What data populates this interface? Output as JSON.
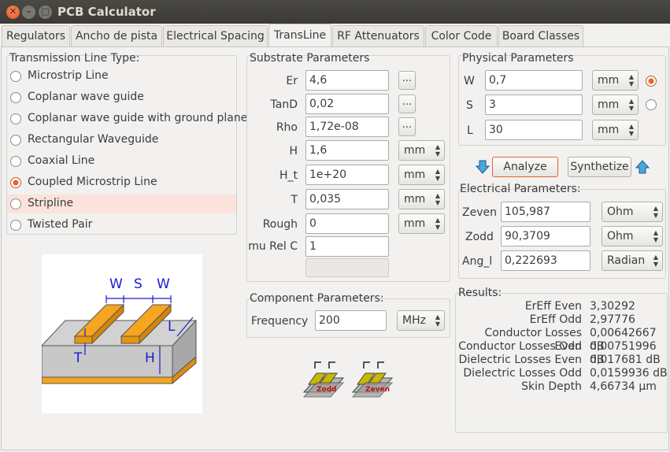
{
  "window": {
    "title": "PCB Calculator"
  },
  "tabs": [
    "Regulators",
    "Ancho de pista",
    "Electrical Spacing",
    "TransLine",
    "RF Attenuators",
    "Color Code",
    "Board Classes"
  ],
  "active_tab": "TransLine",
  "line_type": {
    "label": "Transmission Line Type:",
    "options": [
      "Microstrip Line",
      "Coplanar wave guide",
      "Coplanar wave guide with ground plane",
      "Rectangular Waveguide",
      "Coaxial Line",
      "Coupled Microstrip Line",
      "Stripline",
      "Twisted Pair"
    ],
    "selected": "Coupled Microstrip Line",
    "hover": "Stripline"
  },
  "diagram": {
    "w1": "W",
    "s": "S",
    "w2": "W",
    "t": "T",
    "h": "H",
    "l": "L"
  },
  "substrate": {
    "label": "Substrate Parameters",
    "er": {
      "label": "Er",
      "value": "4,6",
      "btn": "..."
    },
    "tand": {
      "label": "TanD",
      "value": "0,02",
      "btn": "..."
    },
    "rho": {
      "label": "Rho",
      "value": "1,72e-08",
      "btn": "..."
    },
    "h": {
      "label": "H",
      "value": "1,6",
      "unit": "mm"
    },
    "h_t": {
      "label": "H_t",
      "value": "1e+20",
      "unit": "mm"
    },
    "t": {
      "label": "T",
      "value": "0,035",
      "unit": "mm"
    },
    "rough": {
      "label": "Rough",
      "value": "0",
      "unit": "mm"
    },
    "murelc": {
      "label": "mu Rel C",
      "value": "1"
    }
  },
  "component": {
    "label": "Component Parameters:",
    "freq_label": "Frequency",
    "freq_value": "200",
    "freq_unit": "MHz"
  },
  "modes": {
    "odd": "Zodd",
    "even": "Zeven"
  },
  "physical": {
    "label": "Physical Parameters",
    "w": {
      "label": "W",
      "value": "0,7",
      "unit": "mm"
    },
    "s": {
      "label": "S",
      "value": "3",
      "unit": "mm"
    },
    "l": {
      "label": "L",
      "value": "30",
      "unit": "mm"
    },
    "selected": "W"
  },
  "actions": {
    "analyze": "Analyze",
    "synthetize": "Synthetize"
  },
  "electrical": {
    "label": "Electrical Parameters:",
    "zeven": {
      "label": "Zeven",
      "value": "105,987",
      "unit": "Ohm"
    },
    "zodd": {
      "label": "Zodd",
      "value": "90,3709",
      "unit": "Ohm"
    },
    "ang": {
      "label": "Ang_l",
      "value": "0,222693",
      "unit": "Radian"
    }
  },
  "results": {
    "label": "Results:",
    "rows": [
      {
        "k": "ErEff Even",
        "v": "3,30292"
      },
      {
        "k": "ErEff Odd",
        "v": "2,97776"
      },
      {
        "k": "Conductor Losses Even",
        "v": "0,00642667 dB"
      },
      {
        "k": "Conductor Losses Odd",
        "v": "0,00751996 dB"
      },
      {
        "k": "Dielectric Losses Even",
        "v": "0,017681 dB"
      },
      {
        "k": "Dielectric Losses Odd",
        "v": "0,0159936 dB"
      },
      {
        "k": "Skin Depth",
        "v": "4,66734 µm"
      }
    ]
  },
  "colors": {
    "accent": "#e8632f",
    "copper": "#f5a51e",
    "substrate": "#c8c8c8",
    "titlebar": "#3c3b37",
    "arrow": "#4aa8d8"
  }
}
